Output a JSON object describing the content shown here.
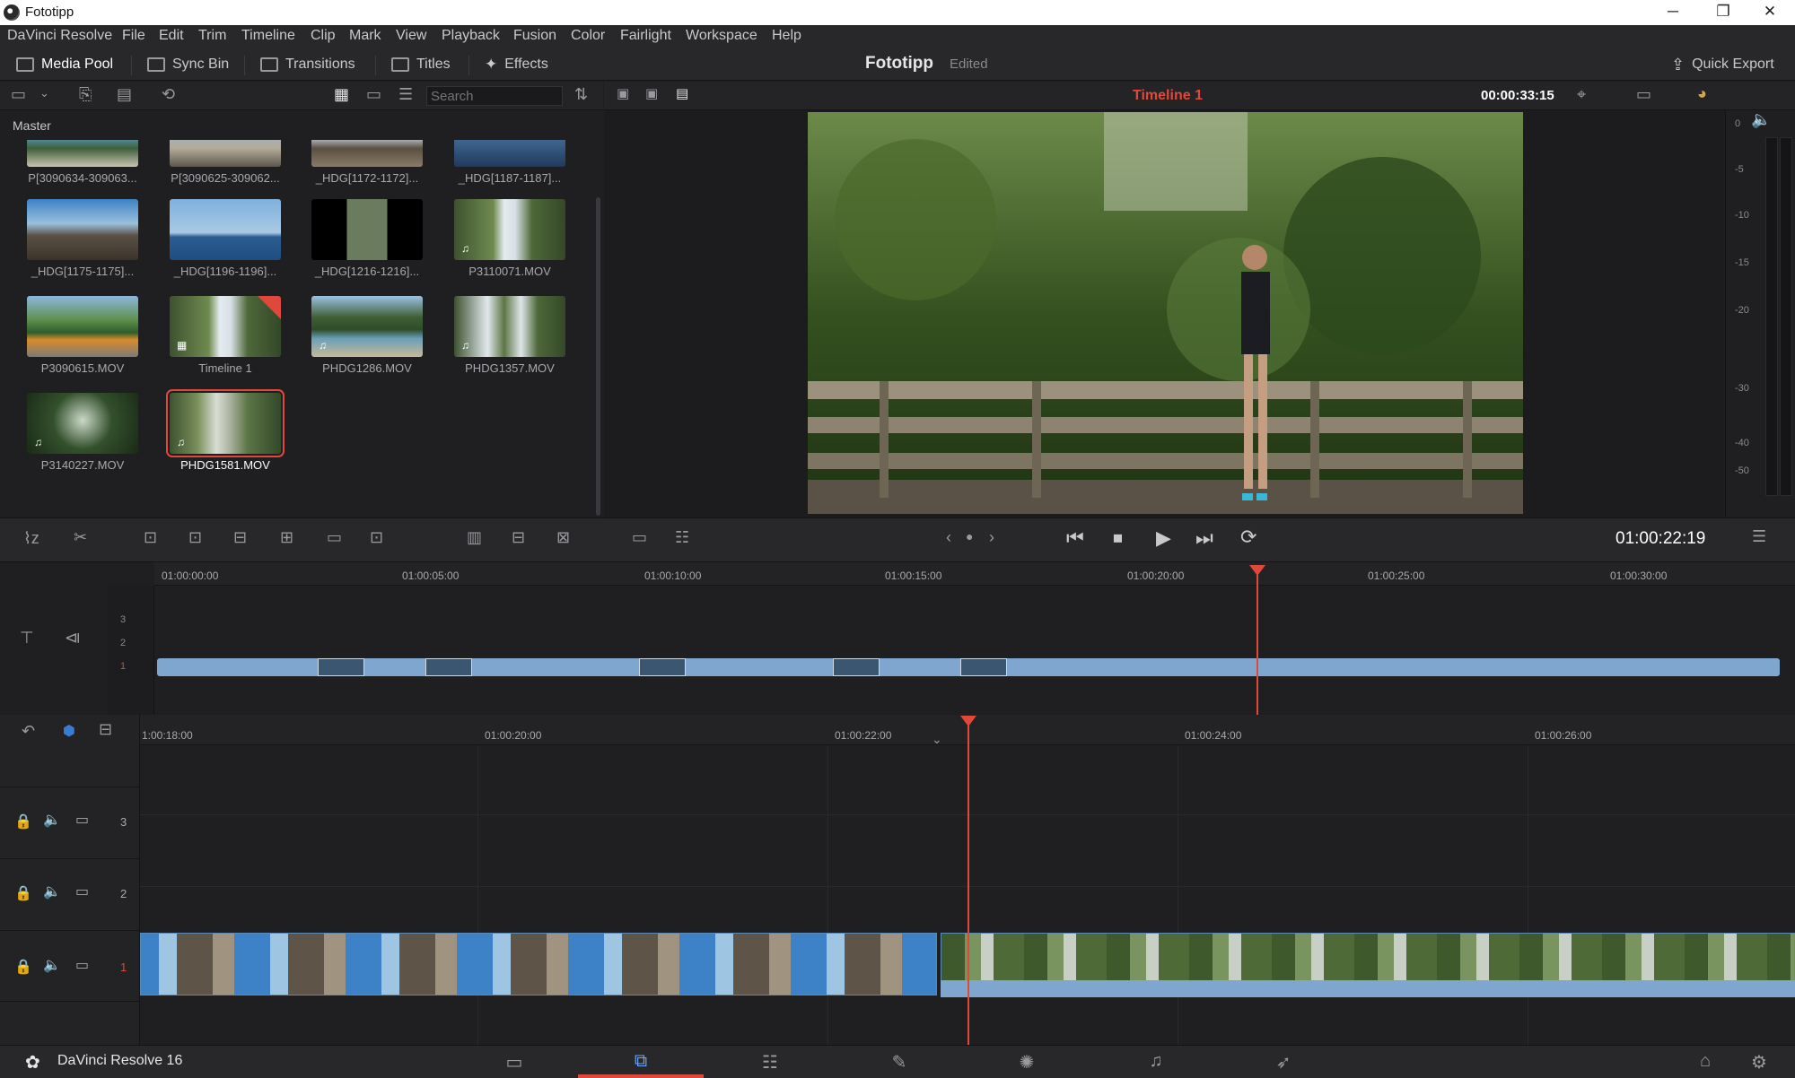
{
  "window": {
    "title": "Fototipp",
    "minimize": "─",
    "restore": "❐",
    "close": "✕"
  },
  "menu": [
    "DaVinci Resolve",
    "File",
    "Edit",
    "Trim",
    "Timeline",
    "Clip",
    "Mark",
    "View",
    "Playback",
    "Fusion",
    "Color",
    "Fairlight",
    "Workspace",
    "Help"
  ],
  "toolbar": {
    "media_pool": "Media Pool",
    "sync_bin": "Sync Bin",
    "transitions": "Transitions",
    "titles": "Titles",
    "effects": "Effects",
    "project_name": "Fototipp",
    "project_status": "Edited",
    "quick_export": "Quick Export"
  },
  "media_pool": {
    "search_placeholder": "Search",
    "bin": "Master",
    "clips": [
      {
        "label": "P[3090634-309063...",
        "selected": false
      },
      {
        "label": "P[3090625-309062...",
        "selected": false
      },
      {
        "label": "_HDG[1172-1172]...",
        "selected": false
      },
      {
        "label": "_HDG[1187-1187]...",
        "selected": false
      },
      {
        "label": "_HDG[1175-1175]...",
        "selected": false
      },
      {
        "label": "_HDG[1196-1196]...",
        "selected": false
      },
      {
        "label": "_HDG[1216-1216]...",
        "selected": false
      },
      {
        "label": "P3110071.MOV",
        "selected": false
      },
      {
        "label": "P3090615.MOV",
        "selected": false
      },
      {
        "label": "Timeline 1",
        "selected": false
      },
      {
        "label": "PHDG1286.MOV",
        "selected": false
      },
      {
        "label": "PHDG1357.MOV",
        "selected": false
      },
      {
        "label": "P3140227.MOV",
        "selected": false
      },
      {
        "label": "PHDG1581.MOV",
        "selected": true
      }
    ]
  },
  "viewer": {
    "timeline_name": "Timeline 1",
    "source_timecode": "00:00:33:15",
    "current_timecode": "01:00:22:19",
    "meter_ticks": [
      "0",
      "-5",
      "-10",
      "-15",
      "-20",
      "-30",
      "-40",
      "-50"
    ]
  },
  "upper_timeline": {
    "ruler": [
      "01:00:00:00",
      "01:00:05:00",
      "01:00:10:00",
      "01:00:15:00",
      "01:00:20:00",
      "01:00:25:00",
      "01:00:30:00"
    ],
    "tracks": [
      "3",
      "2",
      "1"
    ]
  },
  "lower_timeline": {
    "ruler": [
      "1:00:18:00",
      "01:00:20:00",
      "01:00:22:00",
      "01:00:24:00",
      "01:00:26:00"
    ],
    "tracks": [
      "3",
      "2",
      "1"
    ]
  },
  "footer": {
    "app": "DaVinci Resolve 16"
  }
}
